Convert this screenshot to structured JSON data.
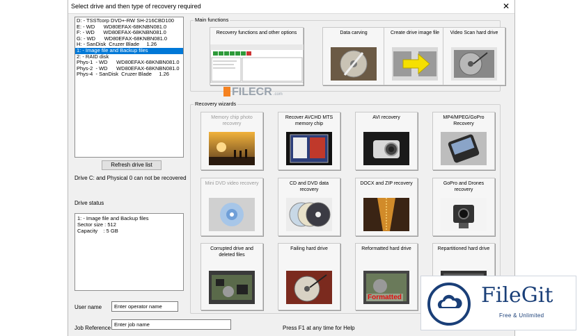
{
  "window": {
    "title": "Select drive and then type of recovery required",
    "close_glyph": "✕"
  },
  "drives": [
    {
      "label": "D: - TSSTcorp DVD+-RW SH-216CBD100",
      "selected": false
    },
    {
      "label": "E: - WD      WD80EFAX-68KNBN081.0",
      "selected": false
    },
    {
      "label": "F: - WD      WD80EFAX-68KNBN081.0",
      "selected": false
    },
    {
      "label": "G: - WD      WD80EFAX-68KNBN081.0",
      "selected": false
    },
    {
      "label": "H: - SanDisk  Cruzer Blade     1.26",
      "selected": false
    },
    {
      "label": "1: - Image file and Backup files",
      "selected": true
    },
    {
      "label": "2: - RAID disk",
      "selected": false
    },
    {
      "label": "Phys-1  - WD      WD80EFAX-68KNBN081.0",
      "selected": false
    },
    {
      "label": "Phys-2  - WD      WD80EFAX-68KNBN081.0",
      "selected": false
    },
    {
      "label": "Phys-4  - SanDisk  Cruzer Blade     1.26",
      "selected": false
    }
  ],
  "left": {
    "refresh_label": "Refresh drive list",
    "note": "Drive C: and Physical 0 can not be recovered",
    "status_label": "Drive status",
    "status_lines": [
      "1: - Image file and Backup files",
      "Sector size : 512",
      "Capacity    : 5 GB"
    ],
    "user_label": "User name",
    "user_placeholder": "Enter operator name",
    "job_label": "Job Reference",
    "job_placeholder": "Enter job name"
  },
  "main_functions": {
    "title": "Main functions",
    "tiles": [
      {
        "label": "Recovery functions and other options",
        "disabled": false
      },
      {
        "label": "Data carving",
        "disabled": false
      },
      {
        "label": "Create drive image file",
        "disabled": false
      },
      {
        "label": "Video Scan hard drive",
        "disabled": false
      }
    ]
  },
  "wizards": {
    "title": "Recovery wizards",
    "tiles": [
      {
        "label": "Memory chip photo recovery",
        "disabled": true
      },
      {
        "label": "Recover AVCHD MTS memory chip",
        "disabled": false
      },
      {
        "label": "AVI recovery",
        "disabled": false
      },
      {
        "label": "MP4/MPEG/GoPro Recovery",
        "disabled": false
      },
      {
        "label": "Mini DVD video recovery",
        "disabled": true
      },
      {
        "label": "CD and DVD data recovery",
        "disabled": false
      },
      {
        "label": "DOCX and ZIP recovery",
        "disabled": false
      },
      {
        "label": "GoPro and Drones recovery",
        "disabled": false
      },
      {
        "label": "Corrupted drive and deleted files",
        "disabled": false
      },
      {
        "label": "Failing hard drive",
        "disabled": false
      },
      {
        "label": "Reformatted hard drive",
        "disabled": false
      },
      {
        "label": "Repartitioned hard drive",
        "disabled": false
      }
    ],
    "formatted_stamp": "Formatted"
  },
  "footer": {
    "hint": "Press F1 at any time for Help"
  },
  "watermarks": {
    "filecr_name": "FILECR",
    "filecr_domain": ".com",
    "filegit_name": "FileGit",
    "filegit_tagline": "Free & Unlimited"
  },
  "colors": {
    "selection": "#0078d7",
    "window_bg": "#f0f0f0",
    "filegit_blue": "#1a3f78"
  }
}
